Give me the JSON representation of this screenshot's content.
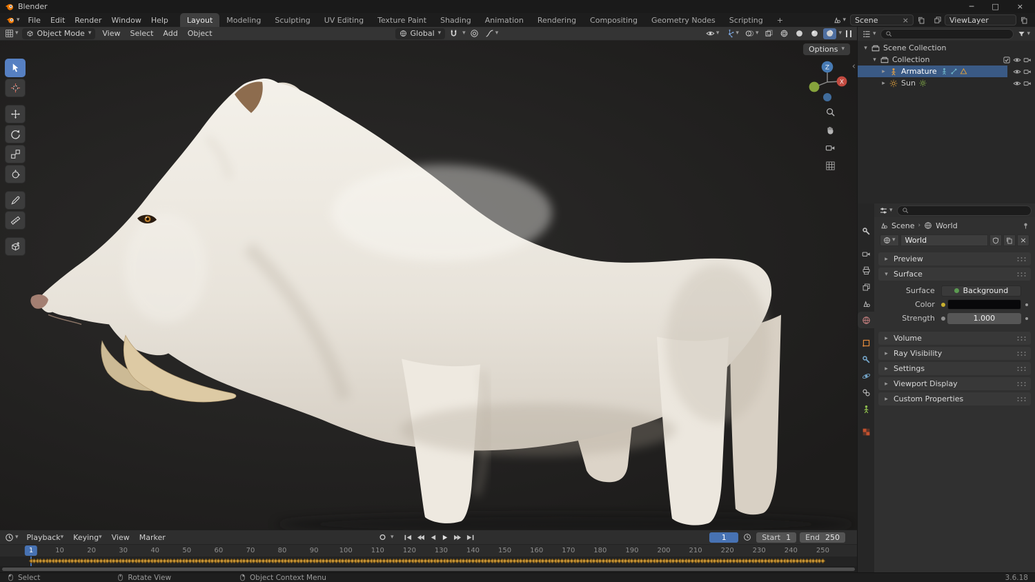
{
  "icons": {
    "dropdown": "▾",
    "disclosure_open": "▾",
    "disclosure_closed": "▸",
    "close": "×",
    "breadcrumb_sep": "›",
    "collapse_left": "‹",
    "minimize": "─",
    "maximize": "□"
  },
  "titlebar": {
    "app_name": "Blender"
  },
  "menubar": {
    "menus": [
      "File",
      "Edit",
      "Render",
      "Window",
      "Help"
    ],
    "workspaces": [
      "Layout",
      "Modeling",
      "Sculpting",
      "UV Editing",
      "Texture Paint",
      "Shading",
      "Animation",
      "Rendering",
      "Compositing",
      "Geometry Nodes",
      "Scripting"
    ],
    "active_workspace": "Layout",
    "add_workspace": "+",
    "scene_label": "Scene",
    "viewlayer_label": "ViewLayer"
  },
  "viewport_header": {
    "mode": "Object Mode",
    "menus": [
      "View",
      "Select",
      "Add",
      "Object"
    ],
    "orientation": "Global",
    "options": "Options"
  },
  "toolbar": {
    "tools": [
      "select-box",
      "cursor",
      "move",
      "rotate",
      "scale",
      "transform",
      "annotate",
      "measure",
      "add-cube"
    ],
    "groups": [
      2,
      4,
      2,
      1
    ],
    "active_tool": "select-box"
  },
  "gizmo": {
    "axis_z": "Z",
    "axis_x": "X"
  },
  "outliner": {
    "rows": [
      {
        "label": "Scene Collection",
        "icon": "scene-collection",
        "depth": 0,
        "disclosure": "open",
        "selected": false,
        "controls": [],
        "badges": []
      },
      {
        "label": "Collection",
        "icon": "collection",
        "depth": 1,
        "disclosure": "open",
        "selected": false,
        "controls": [
          "checkbox",
          "eye",
          "camera"
        ],
        "badges": []
      },
      {
        "label": "Armature",
        "icon": "armature",
        "depth": 2,
        "disclosure": "closed",
        "selected": true,
        "controls": [
          "eye",
          "camera"
        ],
        "badges": [
          "pose",
          "bone",
          "shield"
        ]
      },
      {
        "label": "Sun",
        "icon": "sun",
        "depth": 2,
        "disclosure": "closed",
        "selected": false,
        "controls": [
          "eye",
          "camera"
        ],
        "badges": [
          "sun-data"
        ]
      }
    ]
  },
  "properties": {
    "breadcrumb": {
      "scene": "Scene",
      "world": "World"
    },
    "datablock_name": "World",
    "tabs": [
      "tool",
      "render",
      "output",
      "view-layer",
      "scene",
      "world",
      "object",
      "modifiers",
      "physics",
      "constraints",
      "object-data",
      "texture"
    ],
    "tab_groups": [
      1,
      5,
      5,
      1
    ],
    "active_tab": "world",
    "panels": {
      "preview": "Preview",
      "surface": "Surface",
      "volume": "Volume",
      "ray_visibility": "Ray Visibility",
      "settings": "Settings",
      "viewport_display": "Viewport Display",
      "custom_properties": "Custom Properties"
    },
    "surface": {
      "surface_label": "Surface",
      "surface_value": "Background",
      "color_label": "Color",
      "strength_label": "Strength",
      "strength_value": "1.000"
    }
  },
  "timeline": {
    "menus": [
      "Playback",
      "Keying",
      "View",
      "Marker"
    ],
    "current_frame": "1",
    "start_label": "Start",
    "start_value": "1",
    "end_label": "End",
    "end_value": "250",
    "ticks": [
      10,
      20,
      30,
      40,
      50,
      60,
      70,
      80,
      90,
      100,
      110,
      120,
      130,
      140,
      150,
      160,
      170,
      180,
      190,
      200,
      210,
      220,
      230,
      240,
      250
    ],
    "keyframes": {
      "from": 1,
      "to": 250
    }
  },
  "statusbar": {
    "select": "Select",
    "rotate": "Rotate View",
    "context": "Object Context Menu",
    "version": "3.6.18"
  }
}
